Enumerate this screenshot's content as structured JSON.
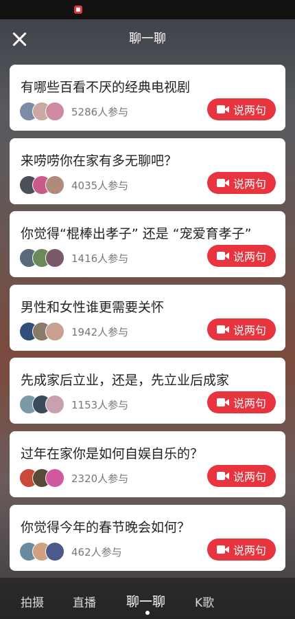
{
  "header": {
    "title": "聊一聊"
  },
  "cards": [
    {
      "title": "有哪些百看不厌的经典电视剧",
      "participants": "5286人参与",
      "button": "说两句",
      "avatars": [
        "#7a8ca6",
        "#c9a9a2",
        "#d08aa0"
      ]
    },
    {
      "title": "来唠唠你在家有多无聊吧？",
      "participants": "4035人参与",
      "button": "说两句",
      "avatars": [
        "#4a4f5a",
        "#c95a8a",
        "#b08a7a"
      ]
    },
    {
      "title": "你觉得“棍棒出孝子” 还是 “宠爱育孝子”",
      "participants": "1416人参与",
      "button": "说两句",
      "avatars": [
        "#5a6a7a",
        "#6a8a5a",
        "#7a5a6a"
      ]
    },
    {
      "title": "男性和女性谁更需要关怀",
      "participants": "1942人参与",
      "button": "说两句",
      "avatars": [
        "#2f4f7a",
        "#8a7a6a",
        "#c8a090"
      ]
    },
    {
      "title": "先成家后立业，还是，先立业后成家",
      "participants": "1153人参与",
      "button": "说两句",
      "avatars": [
        "#7a9aa8",
        "#3a4a5a",
        "#c8a0b0"
      ]
    },
    {
      "title": "过年在家你是如何自娱自乐的？",
      "participants": "2320人参与",
      "button": "说两句",
      "avatars": [
        "#c84a3a",
        "#5a4a3a",
        "#d05aa0"
      ]
    },
    {
      "title": "你觉得今年的春节晚会如何？",
      "participants": "462人参与",
      "button": "说两句",
      "avatars": [
        "#6a8aa0",
        "#d0a080",
        "#4a5a8a"
      ]
    }
  ],
  "nav": {
    "items": [
      "拍摄",
      "直播",
      "聊一聊",
      "K歌"
    ],
    "active": "聊一聊"
  },
  "colors": {
    "accent": "#e8343e"
  }
}
